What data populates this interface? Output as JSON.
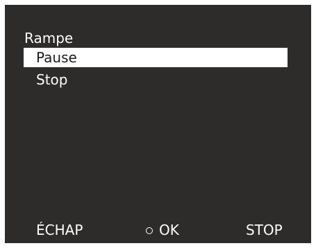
{
  "screen": {
    "background": "#2e2c2b",
    "foreground": "#ffffff"
  },
  "menu": {
    "title": "Rampe",
    "items": [
      {
        "label": "Pause",
        "selected": true
      },
      {
        "label": "Stop",
        "selected": false
      }
    ]
  },
  "softkeys": {
    "back_label": "ÉCHAP",
    "ok_label": "OK",
    "ok_icon": "circle-icon",
    "stop_label": "STOP"
  }
}
